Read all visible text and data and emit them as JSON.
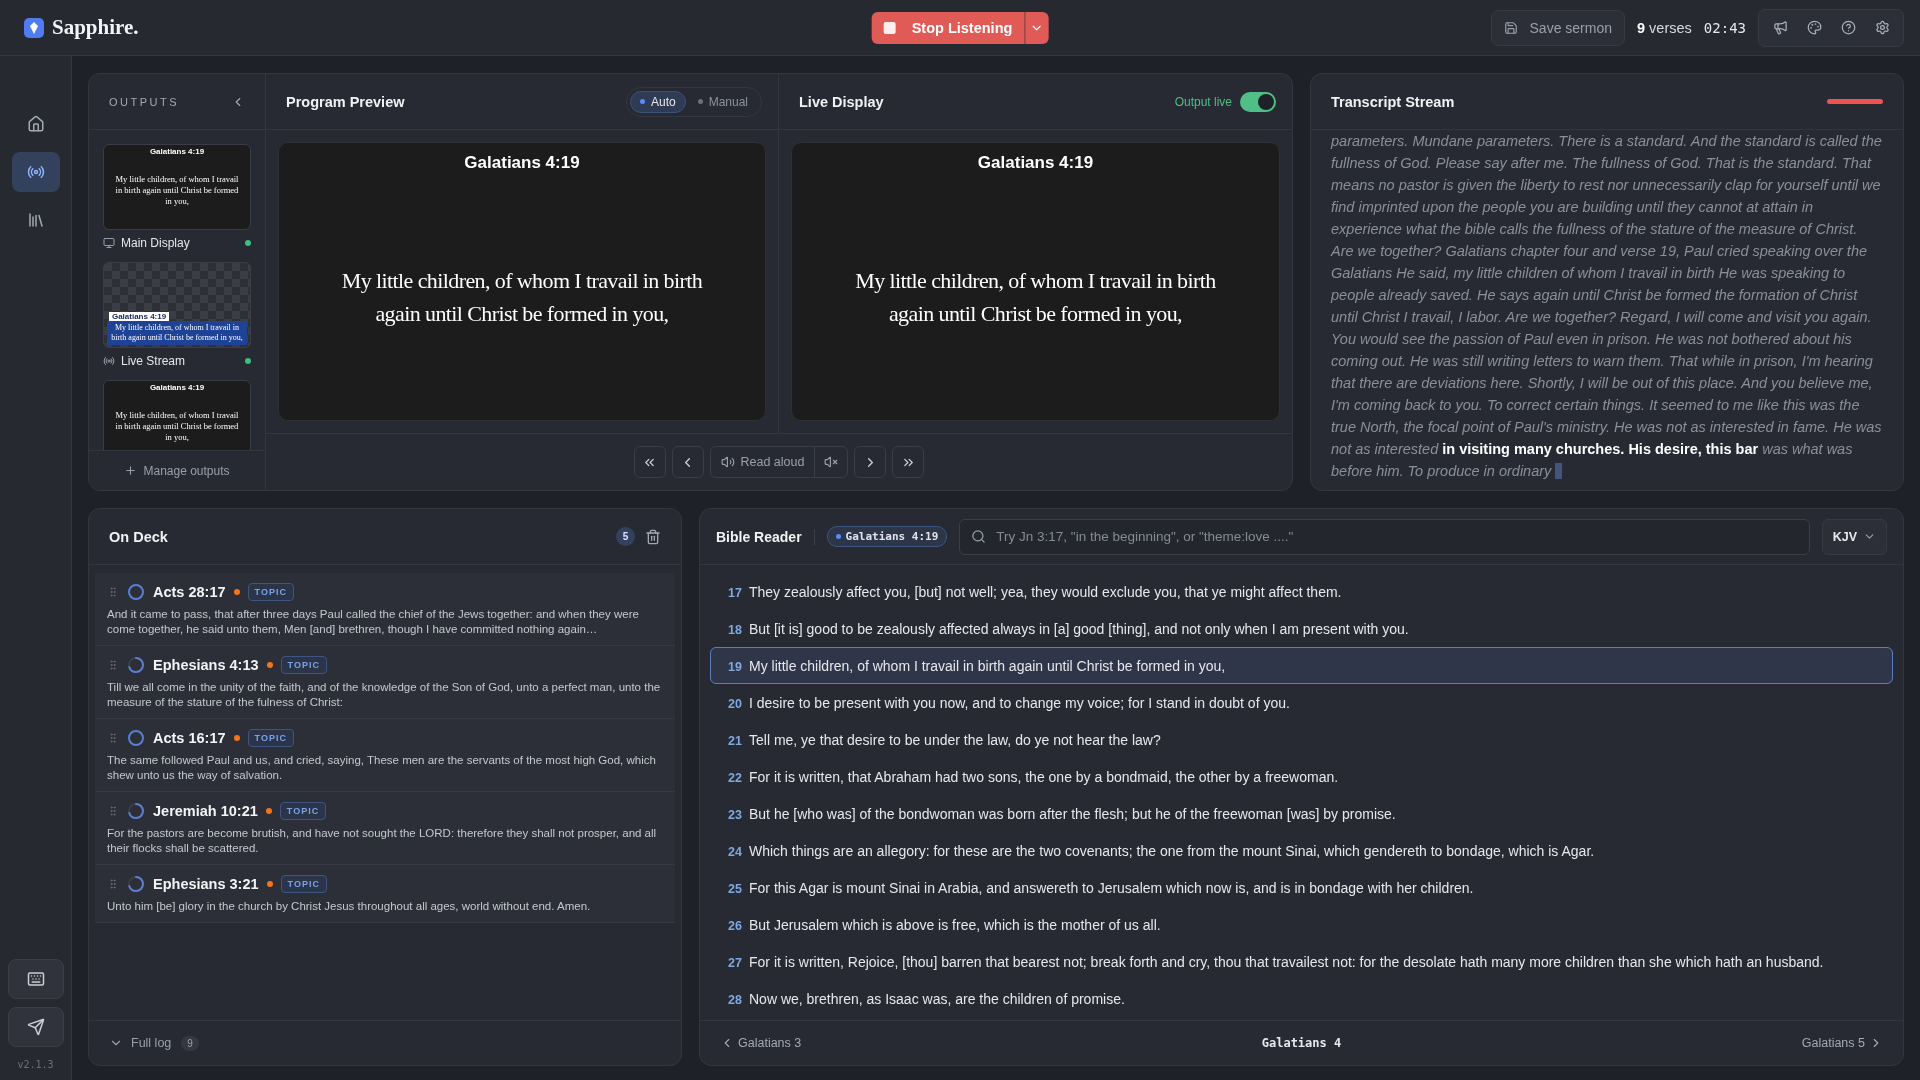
{
  "app": {
    "brand": "Sapphire.",
    "version": "v2.1.3"
  },
  "rail": [
    {
      "kind": "home",
      "selected": false
    },
    {
      "kind": "broadcast",
      "selected": true
    },
    {
      "kind": "library",
      "selected": false
    }
  ],
  "listen_button": {
    "label": "Stop Listening"
  },
  "save_button": {
    "label": "Save sermon"
  },
  "verse_count": "**9** verses",
  "timer": "02:43",
  "outputs": {
    "title": "OUTPUTS",
    "manage": "Manage outputs",
    "items": [
      {
        "label": "Main Display",
        "kind": "display",
        "live": true,
        "slide": {
          "reference": "Galatians 4:19",
          "text": "My little children, of whom I travail in birth again until Christ be formed in you,"
        }
      },
      {
        "label": "Live Stream",
        "kind": "stream",
        "live": true,
        "slide": {
          "reference": "Galatians 4:19",
          "text": "My little children, of whom I travail in birth again until Christ be formed in you,"
        }
      },
      {
        "kind": "display",
        "slide": {
          "reference": "Galatians 4:19",
          "text": "My little children, of whom I travail in birth again until Christ be formed in you,"
        }
      }
    ]
  },
  "program_preview": {
    "title": "Program Preview",
    "modes": [
      {
        "label": "Auto",
        "selected": true
      },
      {
        "label": "Manual",
        "selected": false
      }
    ],
    "slide": {
      "reference": "Galatians 4:19",
      "text": "My little children, of whom I travail in birth again until Christ be formed in you,"
    }
  },
  "live_display": {
    "title": "Live Display",
    "status": "Output live",
    "on": true,
    "slide": {
      "reference": "Galatians 4:19",
      "text": "My little children, of whom I travail in birth again until Christ be formed in you,"
    }
  },
  "transport": {
    "read_aloud": "Read aloud"
  },
  "transcript": {
    "title": "Transcript Stream",
    "text": "parameters. Mundane parameters. There is a standard. And the standard is called the fullness of God. Please say after me. The fullness of God. That is the standard. That means no pastor is given the liberty to rest nor unnecessarily clap for yourself until we find imprinted upon the people you are building until they cannot at attain in experience what the bible calls the fullness of the stature of the measure of Christ. Are we together? Galatians chapter four and verse 19, Paul cried speaking over the Galatians He said, my little children of whom I travail in birth He was speaking to people already saved. He says again until Christ be formed the formation of Christ until Christ I travail, I labor. Are we together? Regard, I will come and visit you again. You would see the passion of Paul even in prison. He was not bothered about his coming out. He was still writing letters to warn them. That while in prison, I'm hearing that there are deviations here. Shortly, I will be out of this place. And you believe me, I'm coming back to you. To correct certain things. It seemed to me like this was the true North, the focal point of Paul's ministry. He was not as interested in fame. He was not as interested **in visiting many churches. His desire, this bar** was what was before him. To produce in ordinary"
  },
  "on_deck": {
    "title": "On Deck",
    "count": "5",
    "items": [
      {
        "reference": "Acts 28:17",
        "loaded": true,
        "color": "#f97316",
        "tag": "TOPIC",
        "text": "And it came to pass, that after three days Paul called the chief of the Jews together: and when they were come together, he said unto them, Men [and] brethren, though I have committed nothing again…"
      },
      {
        "reference": "Ephesians 4:13",
        "loaded": false,
        "color": "#f97316",
        "tag": "TOPIC",
        "text": "Till we all come in the unity of the faith, and of the knowledge of the Son of God, unto a perfect man, unto the measure of the stature of the fulness of Christ:"
      },
      {
        "reference": "Acts 16:17",
        "loaded": true,
        "color": "#f97316",
        "tag": "TOPIC",
        "text": "The same followed Paul and us, and cried, saying, These men are the servants of the most high God, which shew unto us the way of salvation."
      },
      {
        "reference": "Jeremiah 10:21",
        "loaded": false,
        "color": "#f97316",
        "tag": "TOPIC",
        "text": "For the pastors are become brutish, and have not sought the LORD: therefore they shall not prosper, and all their flocks shall be scattered."
      },
      {
        "reference": "Ephesians 3:21",
        "loaded": false,
        "color": "#f97316",
        "tag": "TOPIC",
        "text": "Unto him [be] glory in the church by Christ Jesus throughout all ages, world without end. Amen."
      }
    ],
    "full_log": {
      "label": "Full log",
      "count": "9"
    }
  },
  "bible_reader": {
    "title": "Bible Reader",
    "current": "Galatians 4:19",
    "search": {
      "placeholder": "Try Jn 3:17, \"in the beginning\", or \"theme:love ....\""
    },
    "version": "KJV",
    "verses": [
      {
        "number": "17",
        "text": "They zealously affect you, [but] not well; yea, they would exclude you, that ye might affect them.",
        "selected": false
      },
      {
        "number": "18",
        "text": "But [it is] good to be zealously affected always in [a] good [thing], and not only when I am present with you.",
        "selected": false
      },
      {
        "number": "19",
        "text": "My little children, of whom I travail in birth again until Christ be formed in you,",
        "selected": true
      },
      {
        "number": "20",
        "text": "I desire to be present with you now, and to change my voice; for I stand in doubt of you.",
        "selected": false
      },
      {
        "number": "21",
        "text": "Tell me, ye that desire to be under the law, do ye not hear the law?",
        "selected": false
      },
      {
        "number": "22",
        "text": "For it is written, that Abraham had two sons, the one by a bondmaid, the other by a freewoman.",
        "selected": false
      },
      {
        "number": "23",
        "text": "But he [who was] of the bondwoman was born after the flesh; but he of the freewoman [was] by promise.",
        "selected": false
      },
      {
        "number": "24",
        "text": "Which things are an allegory: for these are the two covenants; the one from the mount Sinai, which gendereth to bondage, which is Agar.",
        "selected": false
      },
      {
        "number": "25",
        "text": "For this Agar is mount Sinai in Arabia, and answereth to Jerusalem which now is, and is in bondage with her children.",
        "selected": false
      },
      {
        "number": "26",
        "text": "But Jerusalem which is above is free, which is the mother of us all.",
        "selected": false
      },
      {
        "number": "27",
        "text": "For it is written, Rejoice, [thou] barren that bearest not; break forth and cry, thou that travailest not: for the desolate hath many more children than she which hath an husband.",
        "selected": false
      },
      {
        "number": "28",
        "text": "Now we, brethren, as Isaac was, are the children of promise.",
        "selected": false
      }
    ],
    "prev": "Galatians 3",
    "chapter": "Galatians 4",
    "next": "Galatians 5"
  }
}
